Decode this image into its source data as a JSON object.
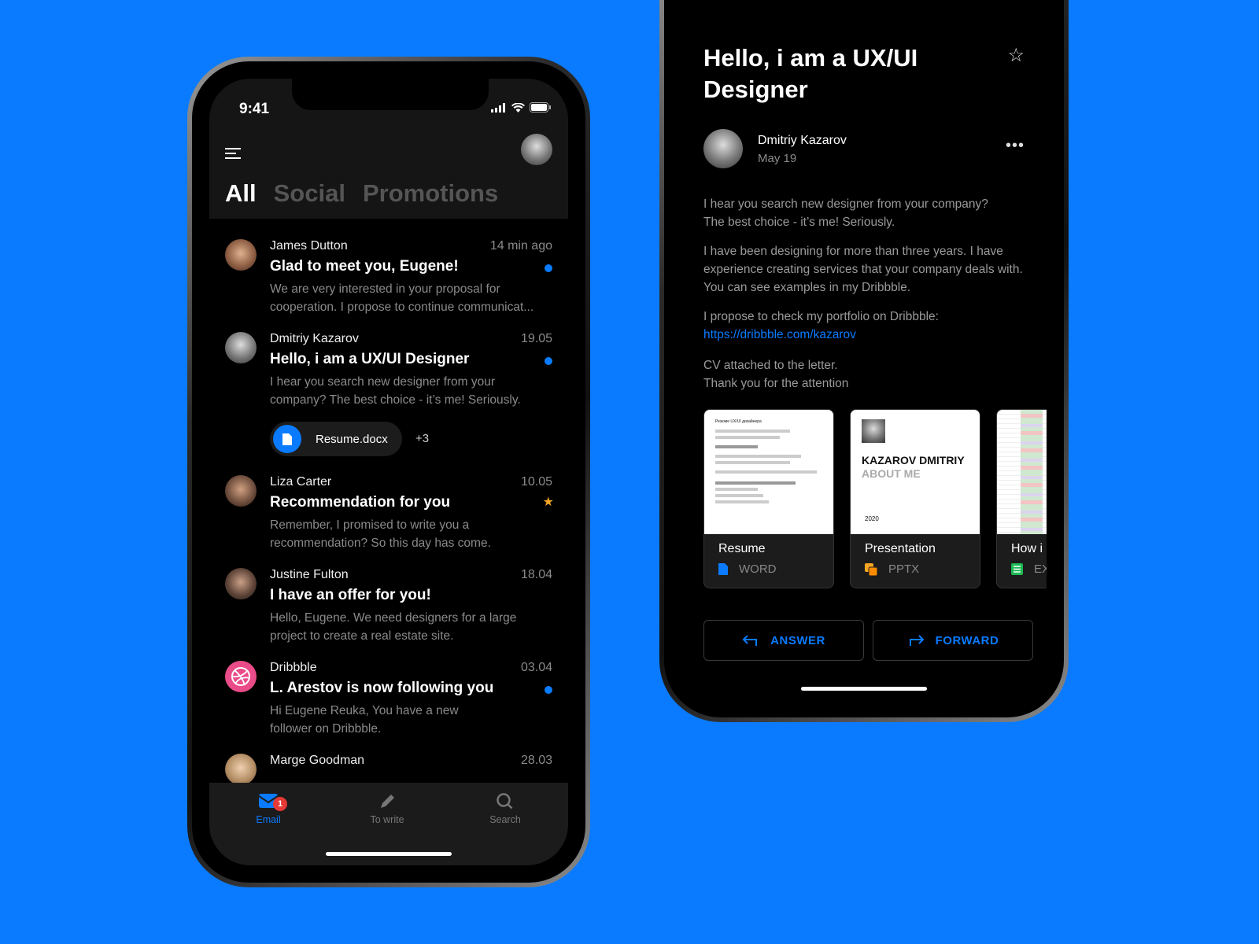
{
  "colors": {
    "background": "#0a7bff",
    "accent": "#0a7bff",
    "badge": "#e53935",
    "star": "#f5a623"
  },
  "left": {
    "status": {
      "time": "9:41"
    },
    "tabs": [
      {
        "label": "All",
        "active": true
      },
      {
        "label": "Social"
      },
      {
        "label": "Promotions"
      }
    ],
    "emails": [
      {
        "from": "James Dutton",
        "date": "14 min ago",
        "subject": "Glad to meet you, Eugene!",
        "preview": "We are very interested in your proposal for cooperation. I propose to continue communicat...",
        "unread": true
      },
      {
        "from": "Dmitriy Kazarov",
        "date": "19.05",
        "subject": "Hello, i am a UX/UI Designer",
        "preview": "I hear you search new designer from your company? The best choice - it’s me! Seriously.",
        "unread": true,
        "attachment": "Resume.docx",
        "more": "+3"
      },
      {
        "from": "Liza Carter",
        "date": "10.05",
        "subject": "Recommendation for you",
        "preview": "Remember, I promised to write you a recommendation? So this day has come.",
        "starred": true
      },
      {
        "from": "Justine Fulton",
        "date": "18.04",
        "subject": "I have an offer for you!",
        "preview": "Hello, Eugene. We need designers for a large project to create a real estate site."
      },
      {
        "from": "Dribbble",
        "date": "03.04",
        "subject": "L. Arestov is now following you",
        "preview": "Hi Eugene Reuka, You have a new follower on Dribbble.",
        "unread": true
      },
      {
        "from": "Marge Goodman",
        "date": "28.03",
        "subject": "",
        "preview": ""
      }
    ],
    "tabbar": [
      {
        "label": "Email",
        "icon": "mail-icon",
        "badge": "1",
        "active": true
      },
      {
        "label": "To write",
        "icon": "pencil-icon"
      },
      {
        "label": "Search",
        "icon": "search-icon"
      }
    ]
  },
  "right": {
    "title": "Hello, i am a UX/UI Designer",
    "sender": "Dmitriy Kazarov",
    "date": "May 19",
    "p1": "I hear you search new designer from your company? The best choice - it’s me! Seriously.",
    "p2": "I have been designing for more than three years. I have experience creating services that your company deals with. You can see examples in my Dribbble.",
    "p3": "I propose to check my portfolio on Dribbble:",
    "link": "https://dribbble.com/kazarov",
    "p4": "CV attached to the letter.",
    "p5": "Thank you for the attention",
    "attachments": [
      {
        "name": "Resume",
        "type": "WORD",
        "icon": "word-file-icon",
        "thumb": "Резюме UX/UI дизайнера"
      },
      {
        "name": "Presentation",
        "type": "PPTX",
        "icon": "pptx-file-icon",
        "thumb_title": "KAZAROV DMITRIY",
        "thumb_sub": "ABOUT ME",
        "thumb_year": "2020"
      },
      {
        "name": "How i",
        "type": "EX",
        "icon": "spreadsheet-icon"
      }
    ],
    "answer": "ANSWER",
    "forward": "FORWARD"
  }
}
